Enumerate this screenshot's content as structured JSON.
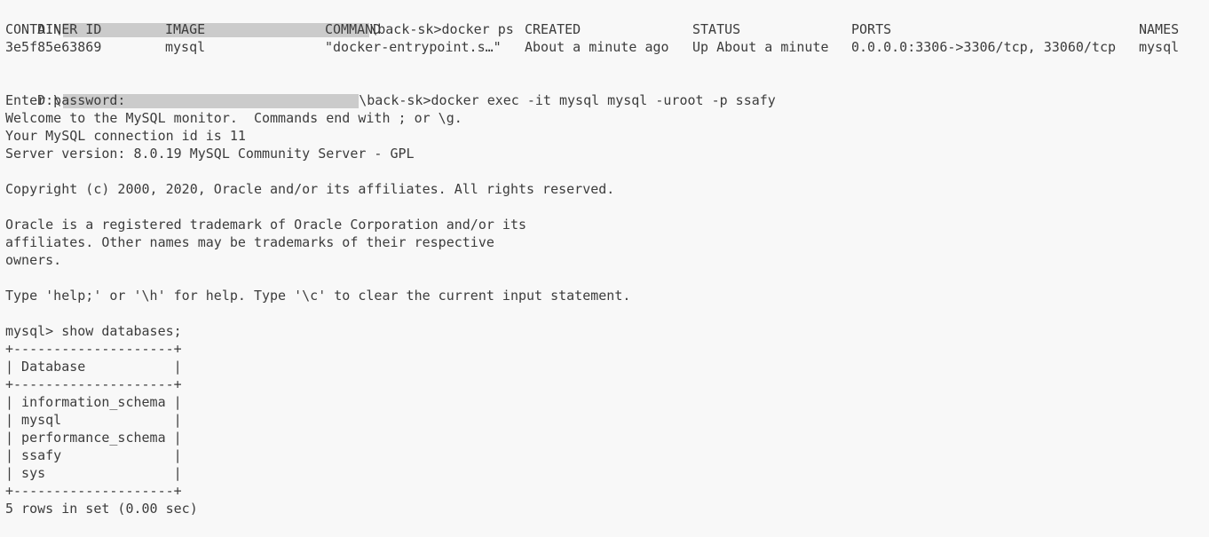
{
  "terminal": {
    "cmd1": {
      "drive": "D:\\",
      "suffix": "\\back-sk>docker ps"
    },
    "ps_headers": [
      "CONTAINER ID",
      "IMAGE",
      "COMMAND",
      "CREATED",
      "STATUS",
      "PORTS",
      "NAMES"
    ],
    "ps_row": [
      "3e5f85e63869",
      "mysql",
      "\"docker-entrypoint.s…\"",
      "About a minute ago",
      "Up About a minute",
      "0.0.0.0:3306->3306/tcp, 33060/tcp",
      "mysql"
    ],
    "cmd2": {
      "drive": "D:\\",
      "suffix": "\\back-sk>docker exec -it mysql mysql -uroot -p ssafy"
    },
    "lines": [
      "Enter password:",
      "Welcome to the MySQL monitor.  Commands end with ; or \\g.",
      "Your MySQL connection id is 11",
      "Server version: 8.0.19 MySQL Community Server - GPL",
      "",
      "Copyright (c) 2000, 2020, Oracle and/or its affiliates. All rights reserved.",
      "",
      "Oracle is a registered trademark of Oracle Corporation and/or its",
      "affiliates. Other names may be trademarks of their respective",
      "owners.",
      "",
      "Type 'help;' or '\\h' for help. Type '\\c' to clear the current input statement.",
      "",
      "mysql> show databases;",
      "+--------------------+",
      "| Database           |",
      "+--------------------+",
      "| information_schema |",
      "| mysql              |",
      "| performance_schema |",
      "| ssafy              |",
      "| sys                |",
      "+--------------------+",
      "5 rows in set (0.00 sec)"
    ]
  }
}
